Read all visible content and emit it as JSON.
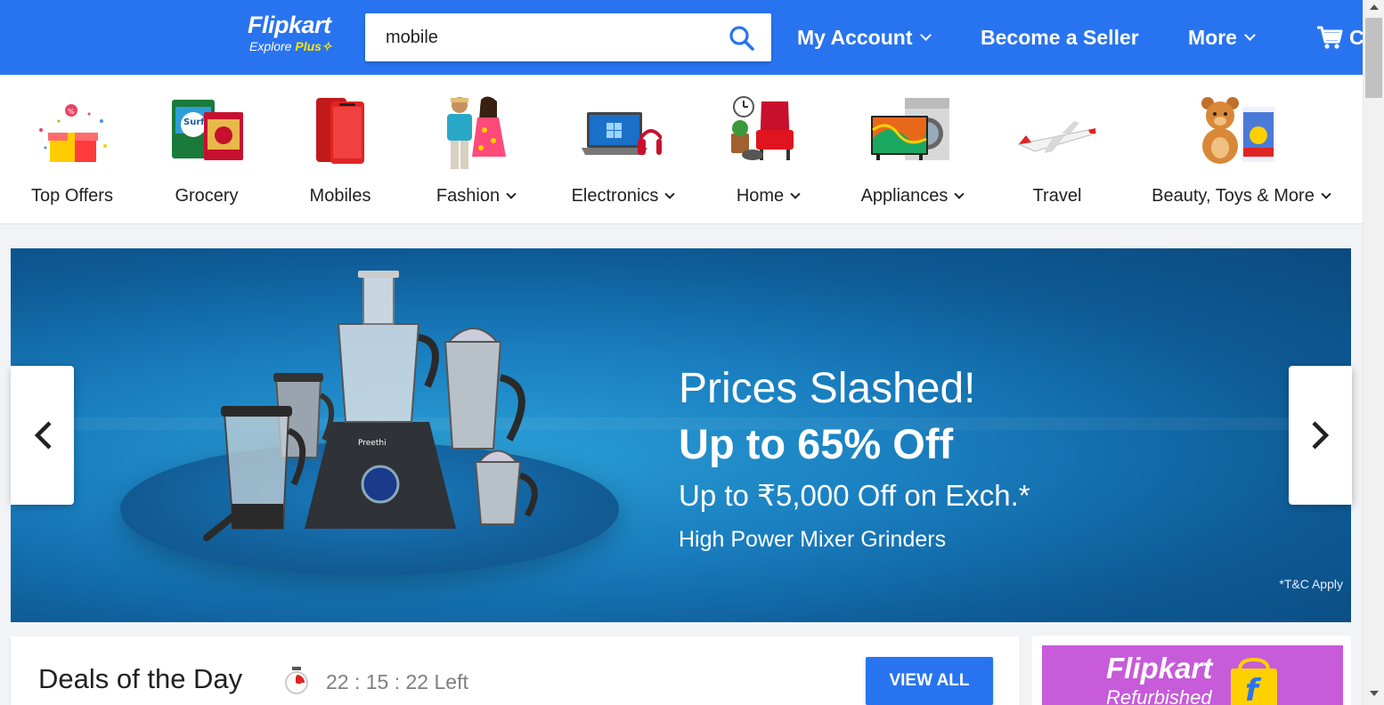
{
  "header": {
    "logo_main": "Flipkart",
    "logo_sub_explore": "Explore",
    "logo_sub_plus": "Plus",
    "search_value": "mobile",
    "nav": {
      "my_account": "My Account",
      "become_seller": "Become a Seller",
      "more": "More",
      "cart": "Cart"
    },
    "brand_color": "#2874f0"
  },
  "categories": [
    {
      "label": "Top Offers",
      "icon": "gift-offer-icon",
      "has_dropdown": false
    },
    {
      "label": "Grocery",
      "icon": "grocery-icon",
      "has_dropdown": false
    },
    {
      "label": "Mobiles",
      "icon": "mobile-phone-icon",
      "has_dropdown": false
    },
    {
      "label": "Fashion",
      "icon": "fashion-icon",
      "has_dropdown": true
    },
    {
      "label": "Electronics",
      "icon": "laptop-headphones-icon",
      "has_dropdown": true
    },
    {
      "label": "Home",
      "icon": "home-furniture-icon",
      "has_dropdown": true
    },
    {
      "label": "Appliances",
      "icon": "tv-washer-icon",
      "has_dropdown": true
    },
    {
      "label": "Travel",
      "icon": "airplane-icon",
      "has_dropdown": false
    },
    {
      "label": "Beauty, Toys & More",
      "icon": "teddy-bear-icon",
      "has_dropdown": true
    }
  ],
  "banner": {
    "title": "Prices Slashed!",
    "offer": "Up to 65% Off",
    "exchange": "Up to ₹5,000 Off on Exch.*",
    "description": "High Power Mixer Grinders",
    "terms": "*T&C Apply",
    "product_brand": "Preethi"
  },
  "deals": {
    "title": "Deals of the Day",
    "timer": "22 : 15 : 22 Left",
    "view_all": "VIEW ALL"
  },
  "refurbished": {
    "logo": "Flipkart",
    "sub": "Refurbished"
  }
}
